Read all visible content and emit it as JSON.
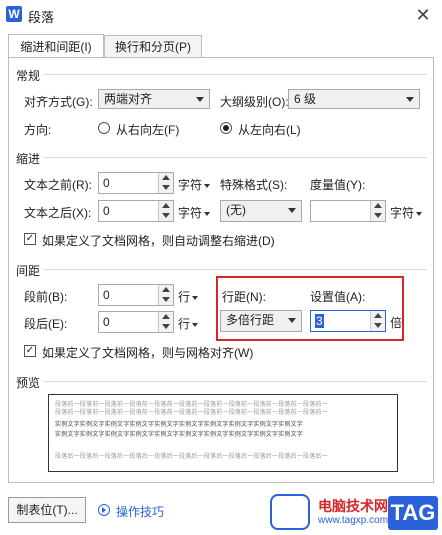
{
  "window": {
    "title": "段落",
    "app_icon": "W",
    "close": "✕"
  },
  "tabs": [
    {
      "label": "缩进和间距(I)",
      "active": true
    },
    {
      "label": "换行和分页(P)",
      "active": false
    }
  ],
  "general": {
    "heading": "常规",
    "align_label": "对齐方式(G):",
    "align_value": "两端对齐",
    "outline_label": "大纲级别(O):",
    "outline_value": "6 级",
    "direction_label": "方向:",
    "rtl_label": "从右向左(F)",
    "ltr_label": "从左向右(L)",
    "selected": "ltr"
  },
  "indent": {
    "heading": "缩进",
    "before_label": "文本之前(R):",
    "before_value": "0",
    "before_unit": "字符",
    "after_label": "文本之后(X):",
    "after_value": "0",
    "after_unit": "字符",
    "special_label": "特殊格式(S):",
    "special_value": "(无)",
    "measure_label": "度量值(Y):",
    "measure_value": "",
    "measure_unit": "字符",
    "grid_check_label": "如果定义了文档网格，则自动调整右缩进(D)",
    "grid_checked": true
  },
  "spacing": {
    "heading": "间距",
    "before_label": "段前(B):",
    "before_value": "0",
    "before_unit": "行",
    "after_label": "段后(E):",
    "after_value": "0",
    "after_unit": "行",
    "line_label": "行距(N):",
    "line_value": "多倍行距",
    "setting_label": "设置值(A):",
    "setting_value": "3",
    "setting_unit": "倍",
    "grid_check_label": "如果定义了文档网格，则与网格对齐(W)",
    "grid_checked": true
  },
  "preview": {
    "heading": "预览",
    "prev_text": "段落前一段落前一段落前一段落前一段落前一段落前一段落前一段落前一段落前一段落前一段落前一",
    "sample_text": "实例文字实例文字实例文字实例文字实例文字实例文字实例文字实例文字实例文字实例文字",
    "next_text": "段落后一段落后一段落后一段落后一段落后一段落后一段落后一段落后一段落后一段落后一段落后一"
  },
  "footer": {
    "tab_button": "制表位(T)...",
    "tips_link": "操作技巧"
  },
  "watermark": {
    "text1": "电脑技术网",
    "text2": "www.tagxp.com",
    "tag": "TAG"
  },
  "colors": {
    "accent": "#2b62d9",
    "highlight": "#d62728"
  }
}
